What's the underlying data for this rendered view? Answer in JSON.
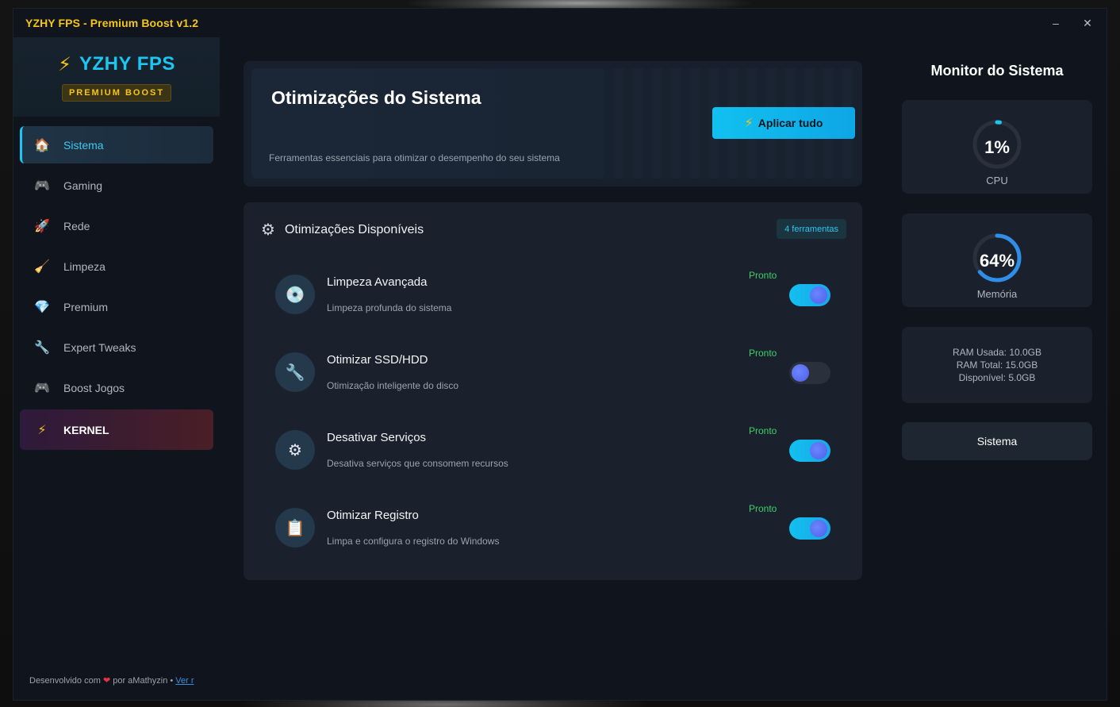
{
  "window": {
    "title": "YZHY FPS - Premium Boost v1.2",
    "minimize_glyph": "–",
    "close_glyph": "✕"
  },
  "brand": {
    "icon": "bolt-icon",
    "name": "YZHY FPS",
    "badge": "PREMIUM BOOST",
    "bolt_glyph": "⚡"
  },
  "sidebar": {
    "items": [
      {
        "label": "Sistema",
        "icon": "house-icon",
        "glyph": "🏠",
        "active": true
      },
      {
        "label": "Gaming",
        "icon": "gamepad-icon",
        "glyph": "🎮",
        "active": false
      },
      {
        "label": "Rede",
        "icon": "rocket-icon",
        "glyph": "🚀",
        "active": false
      },
      {
        "label": "Limpeza",
        "icon": "broom-icon",
        "glyph": "🧹",
        "active": false
      },
      {
        "label": "Premium",
        "icon": "diamond-icon",
        "glyph": "💎",
        "active": false
      },
      {
        "label": "Expert Tweaks",
        "icon": "wrench-icon",
        "glyph": "🔧",
        "active": false
      },
      {
        "label": "Boost Jogos",
        "icon": "gamepad-icon",
        "glyph": "🎮",
        "active": false
      }
    ],
    "kernel": {
      "label": "KERNEL",
      "icon": "bolt-icon",
      "glyph": "⚡"
    },
    "footer": {
      "prefix": "Desenvolvido com",
      "heart": "❤",
      "suffix": "por aMathyzin •",
      "link": "Ver r"
    }
  },
  "hero": {
    "title": "Otimizações do Sistema",
    "subtitle": "Ferramentas essenciais para otimizar o desempenho do seu sistema",
    "apply_label": "Aplicar tudo",
    "apply_glyph": "⚡"
  },
  "panel": {
    "title": "Otimizações Disponíveis",
    "gear_glyph": "⚙",
    "badge": "4 ferramentas",
    "items": [
      {
        "title": "Limpeza Avançada",
        "desc": "Limpeza profunda do sistema",
        "status": "Pronto",
        "enabled": true,
        "icon": "disc-icon",
        "glyph": "💿"
      },
      {
        "title": "Otimizar SSD/HDD",
        "desc": "Otimização inteligente do disco",
        "status": "Pronto",
        "enabled": false,
        "icon": "wrench-icon",
        "glyph": "🔧"
      },
      {
        "title": "Desativar Serviços",
        "desc": "Desativa serviços que consomem recursos",
        "status": "Pronto",
        "enabled": true,
        "icon": "gear-icon",
        "glyph": "⚙"
      },
      {
        "title": "Otimizar Registro",
        "desc": "Limpa e configura o registro do Windows",
        "status": "Pronto",
        "enabled": true,
        "icon": "clipboard-icon",
        "glyph": "📋"
      }
    ]
  },
  "monitor": {
    "title": "Monitor do Sistema",
    "cpu": {
      "value": "1%",
      "label": "CPU",
      "percent": 1
    },
    "memory": {
      "value": "64%",
      "label": "Memória",
      "percent": 64
    },
    "ram": {
      "used": "RAM Usada: 10.0GB",
      "total": "RAM Total: 15.0GB",
      "available": "Disponível: 5.0GB"
    },
    "system_button": "Sistema"
  },
  "colors": {
    "accent": "#1bc6f2",
    "brand_yellow": "#f5c518",
    "status_green": "#3ecf6a"
  }
}
